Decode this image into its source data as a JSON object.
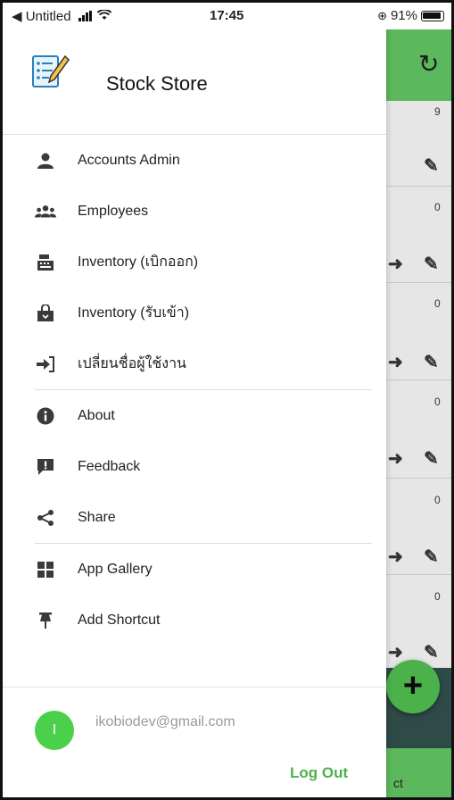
{
  "status_bar": {
    "back_label": "◀ Untitled",
    "time": "17:45",
    "battery": "91%"
  },
  "app": {
    "title": "Stock Store"
  },
  "menu": {
    "items": [
      {
        "label": "Accounts Admin",
        "icon": "user-icon"
      },
      {
        "label": "Employees",
        "icon": "users-icon"
      },
      {
        "label": "Inventory (เบิกออก)",
        "icon": "cash-register-icon"
      },
      {
        "label": "Inventory (รับเข้า)",
        "icon": "shopping-bag-icon"
      },
      {
        "label": "เปลี่ยนชื่อผู้ใช้งาน",
        "icon": "sign-in-icon"
      },
      {
        "label": "About",
        "icon": "info-icon"
      },
      {
        "label": "Feedback",
        "icon": "feedback-icon"
      },
      {
        "label": "Share",
        "icon": "share-icon"
      },
      {
        "label": "App Gallery",
        "icon": "grid-icon"
      },
      {
        "label": "Add Shortcut",
        "icon": "pin-icon"
      }
    ]
  },
  "user": {
    "initial": "I",
    "email": "ikobiodev@gmail.com",
    "logout_label": "Log Out"
  },
  "background": {
    "row_counts": [
      "9",
      "0",
      "0",
      "0",
      "0",
      "0"
    ],
    "footer_text": "ct",
    "fab_label": "+"
  },
  "colors": {
    "accent_green": "#5cb85c",
    "logout_green": "#4cb04c",
    "avatar_green": "#4bd04b"
  }
}
